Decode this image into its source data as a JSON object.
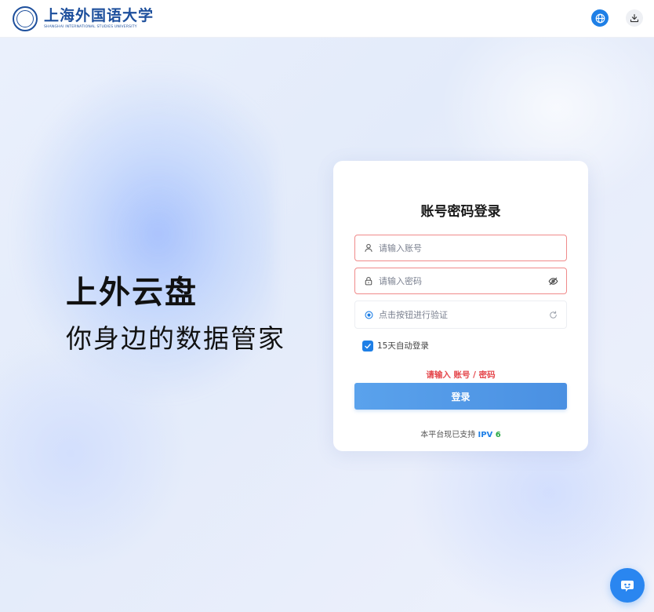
{
  "header": {
    "logo_cn": "上海外国语大学",
    "logo_en": "SHANGHAI INTERNATIONAL STUDIES UNIVERSITY",
    "language_icon": "globe-icon",
    "download_icon": "download-icon"
  },
  "hero": {
    "title": "上外云盘",
    "subtitle": "你身边的数据管家"
  },
  "login": {
    "title": "账号密码登录",
    "account_placeholder": "请输入账号",
    "password_placeholder": "请输入密码",
    "verify_text": "点击按钮进行验证",
    "remember_label": "15天自动登录",
    "remember_checked": true,
    "error_message": "请输入 账号 / 密码",
    "login_button": "登录",
    "ipv_prefix": "本平台现已支持 ",
    "ipv_a": "IPV",
    "ipv_b": " 6"
  },
  "colors": {
    "accent": "#1e7fe6",
    "error": "#e5484d",
    "brand": "#1d4f9c"
  }
}
